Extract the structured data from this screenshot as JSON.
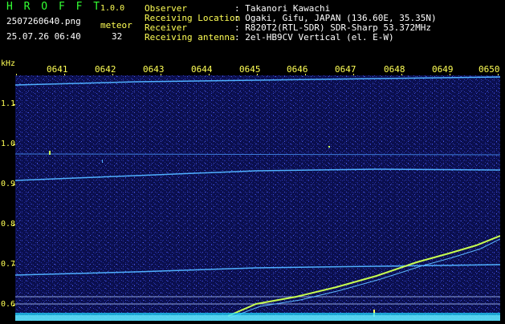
{
  "app": {
    "title": "H R O F F T",
    "version": "1.0.0",
    "filename": "2507260640.png",
    "datetime": "25.07.26 06:40",
    "mode_label": "meteor",
    "meteor_count": "32"
  },
  "info": {
    "observer": {
      "label": "Observer",
      "value": ": Takanori Kawachi"
    },
    "location": {
      "label": "Receiving Location",
      "value": ": Ogaki, Gifu, JAPAN (136.60E, 35.35N)"
    },
    "receiver": {
      "label": "Receiver",
      "value": ": R820T2(RTL-SDR) SDR-Sharp 53.372MHz"
    },
    "antenna": {
      "label": "Receiving antenna",
      "value": ": 2el-HB9CV Vertical (el. E-W)"
    }
  },
  "axis": {
    "unit": "kHz",
    "time_labels": [
      "0641",
      "0642",
      "0643",
      "0644",
      "0645",
      "0646",
      "0647",
      "0648",
      "0649",
      "0650"
    ],
    "freq_labels": [
      "1.1",
      "1.0",
      "0.9",
      "0.8",
      "0.7",
      "0.6"
    ]
  },
  "colors": {
    "background": "#0b0f4e",
    "noise": "#2a35b0",
    "carrier": "#4fb0ff",
    "meteor_trail": "#c8ff50",
    "text_green": "#33ff33",
    "text_yellow": "#ffff55"
  }
}
